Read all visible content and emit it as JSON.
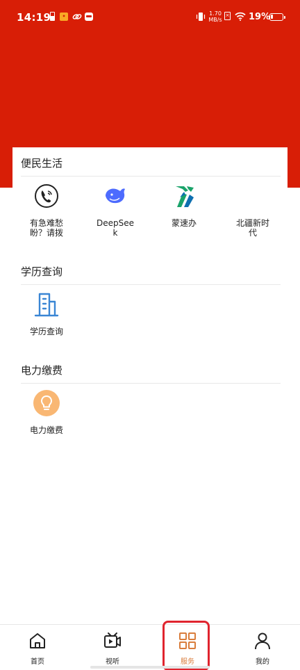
{
  "status_bar": {
    "time": "14:19",
    "net_speed_value": "1.70",
    "net_speed_unit": "MB/s",
    "battery": "19%"
  },
  "colors": {
    "header_red": "#d81e06",
    "active_tab": "#d97d3c",
    "highlight_red": "#e0242e"
  },
  "sections": [
    {
      "title": "便民生活",
      "items": [
        {
          "label": "有急难愁盼？请拨",
          "icon": "phone-circle-icon"
        },
        {
          "label": "DeepSeek",
          "icon": "deepseek-whale-icon"
        },
        {
          "label": "蒙速办",
          "icon": "mengsuban-horse-icon"
        },
        {
          "label": "北疆新时代",
          "icon": "beijiang-newera-icon"
        }
      ]
    },
    {
      "title": "学历查询",
      "items": [
        {
          "label": "学历查询",
          "icon": "building-icon"
        }
      ]
    },
    {
      "title": "电力缴费",
      "items": [
        {
          "label": "电力缴费",
          "icon": "lightbulb-icon"
        }
      ]
    }
  ],
  "tabs": [
    {
      "label": "首页",
      "icon": "home-icon",
      "active": false
    },
    {
      "label": "视听",
      "icon": "tv-play-icon",
      "active": false
    },
    {
      "label": "服务",
      "icon": "grid-services-icon",
      "active": true
    },
    {
      "label": "我的",
      "icon": "person-icon",
      "active": false
    }
  ]
}
